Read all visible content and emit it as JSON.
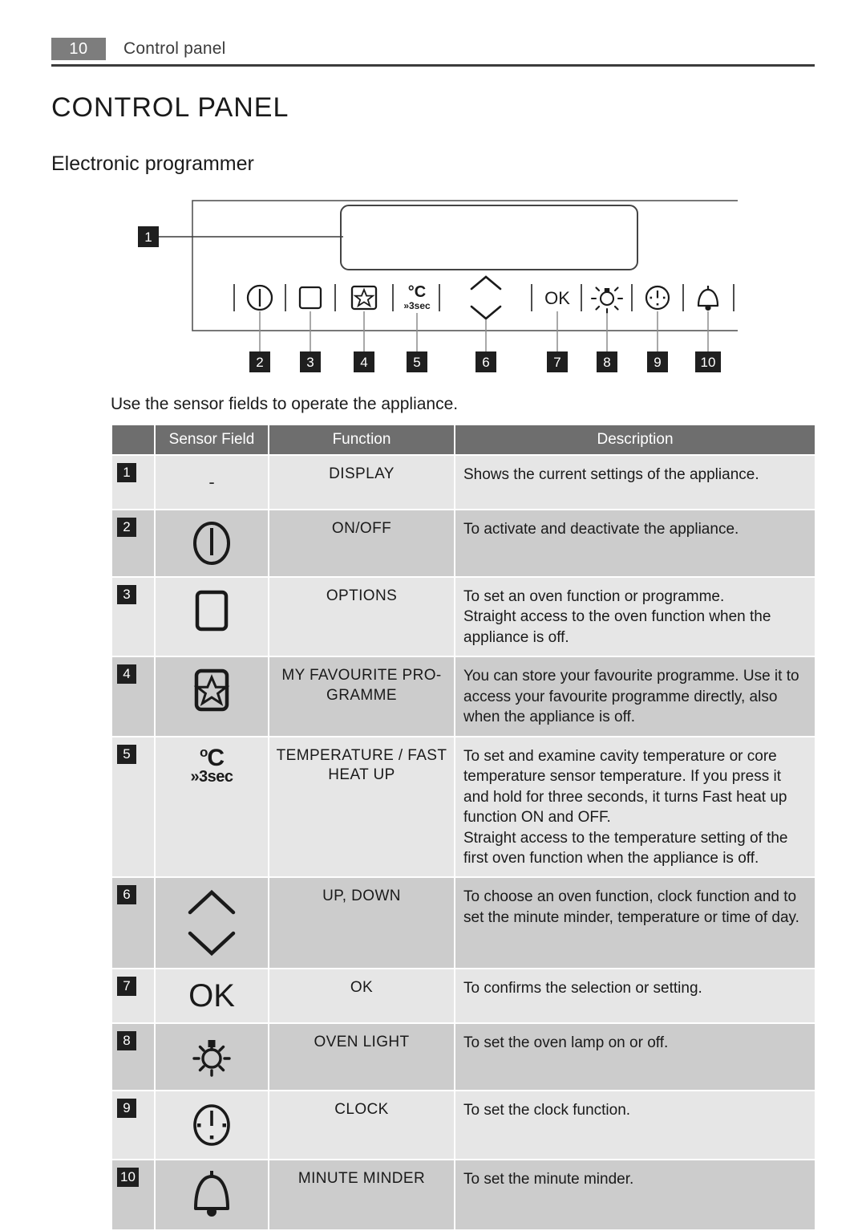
{
  "header": {
    "page_number": "10",
    "title": "Control panel"
  },
  "headings": {
    "h1": "CONTROL PANEL",
    "h2": "Electronic programmer"
  },
  "diagram": {
    "callouts": [
      "1",
      "2",
      "3",
      "4",
      "5",
      "6",
      "7",
      "8",
      "9",
      "10"
    ],
    "sensor_icons": [
      "power-icon",
      "options-square-icon",
      "favourite-star-icon",
      "temperature-3sec-icon",
      "up-down-chevrons-icon",
      "ok-icon",
      "oven-light-icon",
      "clock-icon",
      "minute-minder-bell-icon"
    ],
    "temperature_icon_top": "°C",
    "temperature_icon_bottom": "»3sec",
    "ok_icon_label": "OK"
  },
  "intro": "Use the sensor fields to operate the appliance.",
  "table": {
    "headers": [
      "",
      "Sensor Field",
      "Function",
      "Description"
    ],
    "rows": [
      {
        "index": "1",
        "sensor": "-",
        "sensor_icon": "none",
        "function": "DISPLAY",
        "description": [
          "Shows the current settings of the appliance."
        ]
      },
      {
        "index": "2",
        "sensor": "",
        "sensor_icon": "power-icon",
        "function": "ON/OFF",
        "description": [
          "To activate and deactivate the appliance."
        ]
      },
      {
        "index": "3",
        "sensor": "",
        "sensor_icon": "options-square-icon",
        "function": "OPTIONS",
        "description": [
          "To set an oven function or programme.",
          "Straight access to the oven function when the appliance is off."
        ]
      },
      {
        "index": "4",
        "sensor": "",
        "sensor_icon": "favourite-star-icon",
        "function": "MY FAVOURITE PRO-GRAMME",
        "description": [
          "You can store your favourite programme. Use it to access your favourite programme directly, also when the appliance is off."
        ]
      },
      {
        "index": "5",
        "sensor": "",
        "sensor_icon": "temperature-3sec-icon",
        "function": "TEMPERATURE / FAST HEAT UP",
        "description": [
          "To set and examine cavity temperature or core temperature sensor temperature. If you press it and hold for three seconds, it turns Fast heat up function ON and OFF.",
          "Straight access to the temperature setting of the first oven function when the appliance is off."
        ]
      },
      {
        "index": "6",
        "sensor": "",
        "sensor_icon": "up-down-chevrons-icon",
        "function": "UP, DOWN",
        "description": [
          "To choose an oven function, clock function and to set the minute minder, temperature or time of day."
        ]
      },
      {
        "index": "7",
        "sensor": "OK",
        "sensor_icon": "ok-icon",
        "function": "OK",
        "description": [
          "To confirms the selection or setting."
        ]
      },
      {
        "index": "8",
        "sensor": "",
        "sensor_icon": "oven-light-icon",
        "function": "OVEN LIGHT",
        "description": [
          "To set the oven lamp on or off."
        ]
      },
      {
        "index": "9",
        "sensor": "",
        "sensor_icon": "clock-icon",
        "function": "CLOCK",
        "description": [
          "To set the clock function."
        ]
      },
      {
        "index": "10",
        "sensor": "",
        "sensor_icon": "minute-minder-bell-icon",
        "function": "MINUTE MINDER",
        "description": [
          "To set the minute minder."
        ]
      }
    ]
  },
  "colors": {
    "header_band": "#7d7d7d",
    "table_head": "#6e6e6e",
    "row_light": "#e6e6e6",
    "row_dark": "#cccccc",
    "badge": "#1f1f1f",
    "ink": "#1a1a1a"
  }
}
